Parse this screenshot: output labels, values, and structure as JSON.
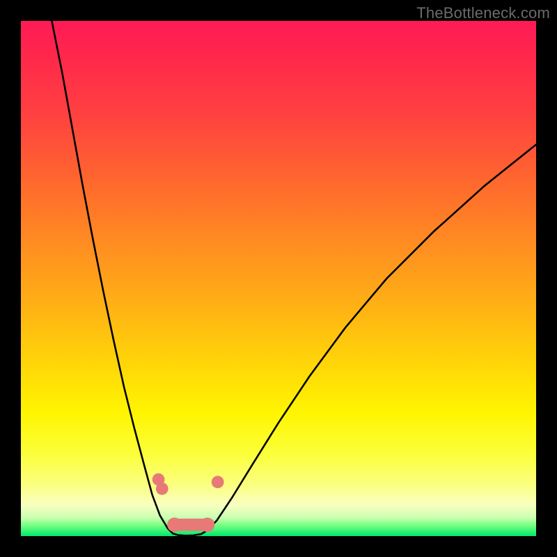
{
  "watermark": "TheBottleneck.com",
  "chart_data": {
    "type": "line",
    "title": "",
    "xlabel": "",
    "ylabel": "",
    "xlim": [
      0,
      100
    ],
    "ylim": [
      0,
      100
    ],
    "grid": false,
    "legend": false,
    "background": "heat-gradient (red top → green bottom)",
    "series": [
      {
        "name": "left-branch",
        "x": [
          6,
          8,
          10,
          12,
          14,
          16,
          18,
          20,
          22,
          24,
          25.5,
          27,
          28.5,
          29.5
        ],
        "y": [
          100,
          90,
          79,
          68,
          57.5,
          47.5,
          38,
          29,
          21,
          13.5,
          8,
          4,
          1.5,
          0.5
        ],
        "color": "#000000"
      },
      {
        "name": "valley-floor",
        "x": [
          29.5,
          30.5,
          32,
          33.5,
          35,
          36
        ],
        "y": [
          0.5,
          0.2,
          0.1,
          0.15,
          0.4,
          1.0
        ],
        "color": "#000000"
      },
      {
        "name": "right-branch",
        "x": [
          36,
          38,
          41,
          45,
          50,
          56,
          63,
          71,
          80,
          90,
          100
        ],
        "y": [
          1.0,
          3.0,
          7.5,
          14,
          22,
          31,
          40.5,
          50,
          59,
          68,
          76
        ],
        "color": "#000000"
      }
    ],
    "markers": [
      {
        "name": "left-dot-upper",
        "x": 26.7,
        "y": 11.0,
        "r": 1.2,
        "color": "#e77a77"
      },
      {
        "name": "left-dot-lower",
        "x": 27.4,
        "y": 9.2,
        "r": 1.2,
        "color": "#e77a77"
      },
      {
        "name": "right-dot-upper",
        "x": 38.2,
        "y": 10.5,
        "r": 1.2,
        "color": "#e77a77"
      },
      {
        "name": "floor-cap-left",
        "x": 29.8,
        "y": 2.2,
        "r": 1.4,
        "color": "#e77a77"
      },
      {
        "name": "floor-cap-right",
        "x": 36.2,
        "y": 2.2,
        "r": 1.4,
        "color": "#e77a77"
      }
    ],
    "valley_bar": {
      "x0": 29.8,
      "x1": 36.2,
      "y": 2.2,
      "thickness": 2.4,
      "color": "#e77a77"
    },
    "notes": "No axis ticks or labels are visible; values are percent-of-plot-area estimates."
  }
}
